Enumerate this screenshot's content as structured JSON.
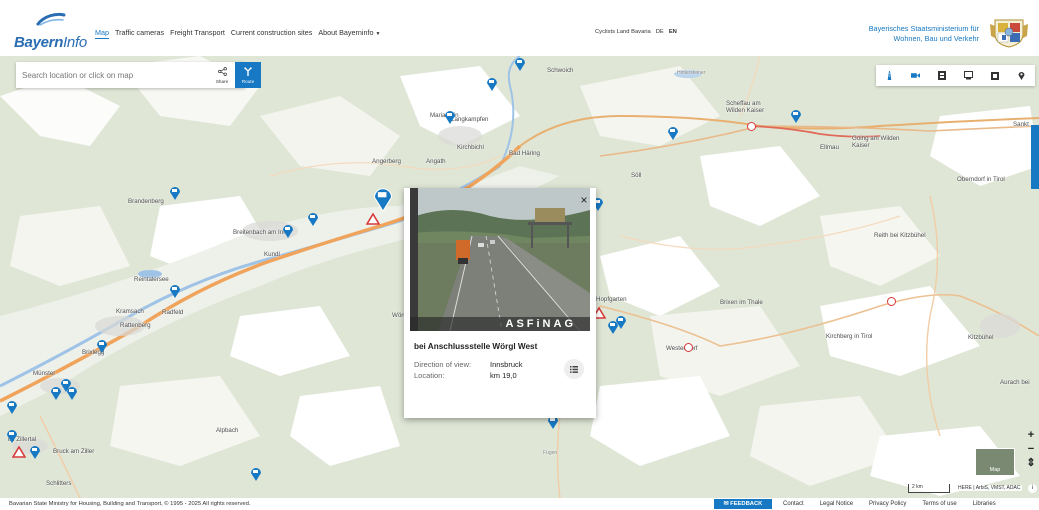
{
  "header": {
    "logo_text_main": "Bayern",
    "logo_text_info": "Info",
    "nav": [
      "Map",
      "Traffic cameras",
      "Freight Transport",
      "Current construction sites",
      "About Bayerninfo"
    ],
    "cyclists_link": "Cyclists Land Bavaria",
    "lang_de": "DE",
    "lang_en": "EN",
    "ministry_line1": "Bayerisches Staatsministerium für",
    "ministry_line2": "Wohnen, Bau und Verkehr"
  },
  "search": {
    "placeholder": "Search location or click on map",
    "share_label": "Share",
    "route_label": "Route"
  },
  "layers": [
    "traffic-icon",
    "camera-icon",
    "parking-icon",
    "truck-icon",
    "charging-icon",
    "location-icon"
  ],
  "places": [
    "Schwoich",
    "Hintersteiner",
    "Scheffau am Wilden Kaiser",
    "Söll",
    "Going am Wilden Kaiser",
    "Ellmau",
    "Sankt",
    "Mariastein",
    "Angerberg",
    "Angath",
    "Langkampfen",
    "Kirchbichl",
    "Bad Häring",
    "Brandenberg",
    "Breitenbach am Inn",
    "Kundl",
    "Oberndorf in Tirol",
    "Reith bei Kitzbühel",
    "Reintalersee",
    "Kramsach",
    "Radfeld",
    "Rattenberg",
    "Brixlegg",
    "Münster",
    "Wörgl",
    "Westendorf",
    "Brixen im Thale",
    "Kirchberg in Tirol",
    "Kitzbühel",
    "Aurach bei",
    "Alpbach",
    "Hopfgarten",
    "Fügen",
    "Bruck am Ziller",
    "Schlitters",
    "im Zillertal"
  ],
  "popup": {
    "watermark": "ASFiNAG",
    "title": "bei Anschlussstelle Wörgl West",
    "direction_label": "Direction of view:",
    "direction_value": "Innsbruck",
    "location_label": "Location:",
    "location_value": "km 19,0",
    "close_label": "×"
  },
  "map_controls": {
    "zoom_in": "+",
    "zoom_out": "−",
    "compass": "⇕",
    "minimap_label": "Map",
    "scale_label": "2 km",
    "attribution": "HERE | ArbiS, VMST, ADAC",
    "info": "i"
  },
  "footer": {
    "copyright": "Bavarian State Ministry for Housing, Building and Transport, © 1995 - 2025 All rights reserved.",
    "feedback": "FEEDBACK",
    "links": [
      "Contact",
      "Legal Notice",
      "Privacy Policy",
      "Terms of use",
      "Libraries"
    ]
  },
  "colors": {
    "accent": "#1779c3",
    "warning": "#d83a3a",
    "road_major": "#f0a35a"
  }
}
